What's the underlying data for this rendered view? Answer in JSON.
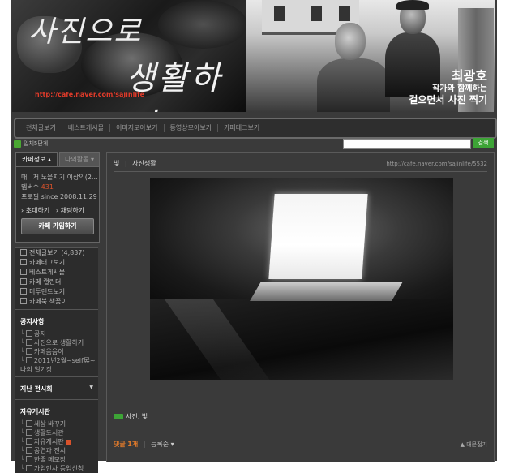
{
  "banner": {
    "title_line1": "사진으로",
    "title_line2": "생활하기",
    "url": "http://cafe.naver.com/sajinlife",
    "author_name": "최광호",
    "subtitle1": "작가와 함께하는",
    "subtitle2": "걸으면서 사진 찍기"
  },
  "menu": {
    "items": [
      "전체글보기",
      "베스트게시물",
      "이미지모아보기",
      "동영상모아보기",
      "카페태그보기"
    ]
  },
  "stage": {
    "label": "입체5단계"
  },
  "search": {
    "placeholder": "",
    "button": "검색"
  },
  "sidebar": {
    "tab_cafe_info": "카페정보 ▴",
    "tab_my_activity": "나의활동 ▾",
    "manager_label": "매니저",
    "manager_value": "노을지기 이상익(2...",
    "members_label": "멤버수",
    "members_value": "431",
    "profile_label": "프로필",
    "since": "since 2008.11.29",
    "invite": "초대하기",
    "chat": "채팅하기",
    "join_button": "카페 가입하기",
    "links": [
      {
        "label": "전체글보기",
        "count": "(4,837)"
      },
      {
        "label": "카페태그보기",
        "count": ""
      },
      {
        "label": "베스트게시물",
        "count": ""
      },
      {
        "label": "카페 캘린더",
        "count": ""
      },
      {
        "label": "미투랜드보기",
        "count": ""
      },
      {
        "label": "카페북 책꽂이",
        "count": ""
      }
    ],
    "notice_head": "공지사항",
    "notice_items": [
      "공지",
      "사진으로 생활하기",
      "카페음음이",
      "2011년2월~self展~나의 일기장"
    ],
    "past_exhibit_head": "지난 전시회",
    "free_board_head": "자유게시판",
    "free_items": [
      "세상 바꾸기",
      "생활도서관",
      "자유게시판",
      "공연과 전시",
      "한줄 메모장",
      "가입인사 등업신청"
    ]
  },
  "post": {
    "category": "빛",
    "board": "사진생활",
    "url": "http://cafe.naver.com/sajinlife/5532",
    "tags": "사진, 빛",
    "comments_label": "댓글",
    "comments_count": "1개",
    "sort_label": "등록순",
    "fold_label": "▲ 대문접기"
  }
}
